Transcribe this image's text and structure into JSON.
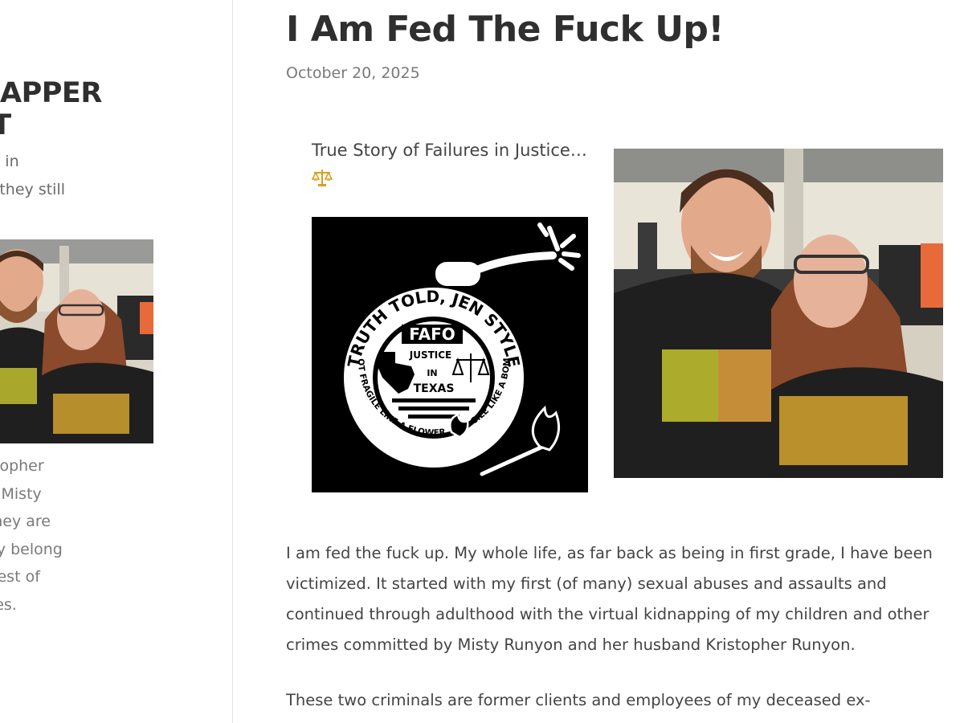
{
  "sidebar": {
    "title": "ONAPPER\nERT",
    "subtitle": "pers belong in\n So why are they still\ng free?",
    "caption": "ed are Kristopher\nn (left) and Misty\nn (right). They are\nals and they belong\non for the rest of\niserable lives."
  },
  "post": {
    "title": "I Am Fed The Fuck Up!",
    "date": "October 20, 2025",
    "intro": "True Story of Failures in Justice…",
    "intro_icon": "balance-scale-icon",
    "logo": {
      "arc_top": "TRUTH TOLD, JEN STYLE",
      "arc_bottom": "NOT FRAGILE LIKE A FLOWER...FRAGILE LIKE A BOMB",
      "badge": "FAFO",
      "line1": "JUSTICE",
      "line2": "IN",
      "line3": "TEXAS"
    },
    "paragraphs": [
      "I am fed the fuck up. My whole life, as far back as being in first grade, I have been victimized. It started with my first (of many) sexual abuses and assaults and continued through adulthood with the virtual kidnapping of my children and other crimes committed by Misty Runyon and her husband Kristopher Runyon.",
      "These two criminals are former clients and employees of my deceased ex-"
    ]
  },
  "colors": {
    "text": "#444444",
    "title": "#2f2f2f",
    "muted": "#7a7a7a",
    "divider": "#e5e5e5"
  }
}
